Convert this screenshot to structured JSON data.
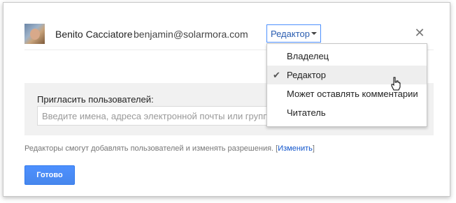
{
  "user": {
    "name": "Benito Cacciatore",
    "email": "benjamin@solarmora.com",
    "role": "Редактор"
  },
  "menu": {
    "items": [
      {
        "label": "Владелец",
        "checked": false
      },
      {
        "label": "Редактор",
        "checked": true
      },
      {
        "label": "Может оставлять комментарии",
        "checked": false
      },
      {
        "label": "Читатель",
        "checked": false
      }
    ]
  },
  "invite": {
    "label": "Пригласить пользователей:",
    "placeholder": "Введите имена, адреса электронной почты или группы"
  },
  "hint": {
    "text": "Редакторы смогут добавлять пользователей и изменять разрешения.",
    "link_label": "Изменить"
  },
  "done_label": "Готово",
  "icons": {
    "close": "close-icon",
    "check": "check-icon",
    "caret": "chevron-down-icon",
    "cursor": "hand-cursor-icon"
  },
  "colors": {
    "accent": "#4d90fe",
    "link": "#1155cc"
  }
}
